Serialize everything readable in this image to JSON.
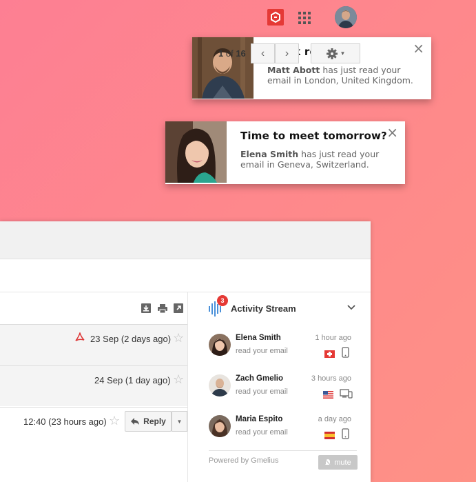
{
  "notifications": [
    {
      "title": "Quick request",
      "name": "Matt Abott",
      "message": "has just read your email in London, United Kingdom.",
      "close": "×"
    },
    {
      "title": "Time to meet tomorrow?",
      "name": "Elena Smith",
      "message": "has just read your email in Geneva, Switzerland.",
      "close": "×"
    }
  ],
  "pager": {
    "current": "1",
    "of": "of",
    "total": "16"
  },
  "emails": [
    {
      "date": "23 Sep (2 days ago)",
      "star": "☆",
      "has_pdf": true
    },
    {
      "date": "24 Sep (1 day ago)",
      "star": "☆",
      "has_pdf": false
    },
    {
      "date": "12:40 (23 hours ago)",
      "star": "☆",
      "has_pdf": false
    }
  ],
  "reply": {
    "label": "Reply"
  },
  "activity": {
    "title": "Activity Stream",
    "badge": "3",
    "items": [
      {
        "name": "Elena Smith",
        "sub": "read your email",
        "time": "1 hour ago",
        "flag": "switzerland",
        "device": "phone"
      },
      {
        "name": "Zach Gmelio",
        "sub": "read your email",
        "time": "3 hours ago",
        "flag": "usa",
        "device": "desktop"
      },
      {
        "name": "Maria Espito",
        "sub": "read your email",
        "time": "a day ago",
        "flag": "spain",
        "device": "phone"
      }
    ],
    "powered": "Powered by Gmelius",
    "mute": "mute"
  },
  "colors": {
    "accent": "#e53935",
    "stream_blue": "#4a90d9",
    "background": "#fd8490"
  }
}
